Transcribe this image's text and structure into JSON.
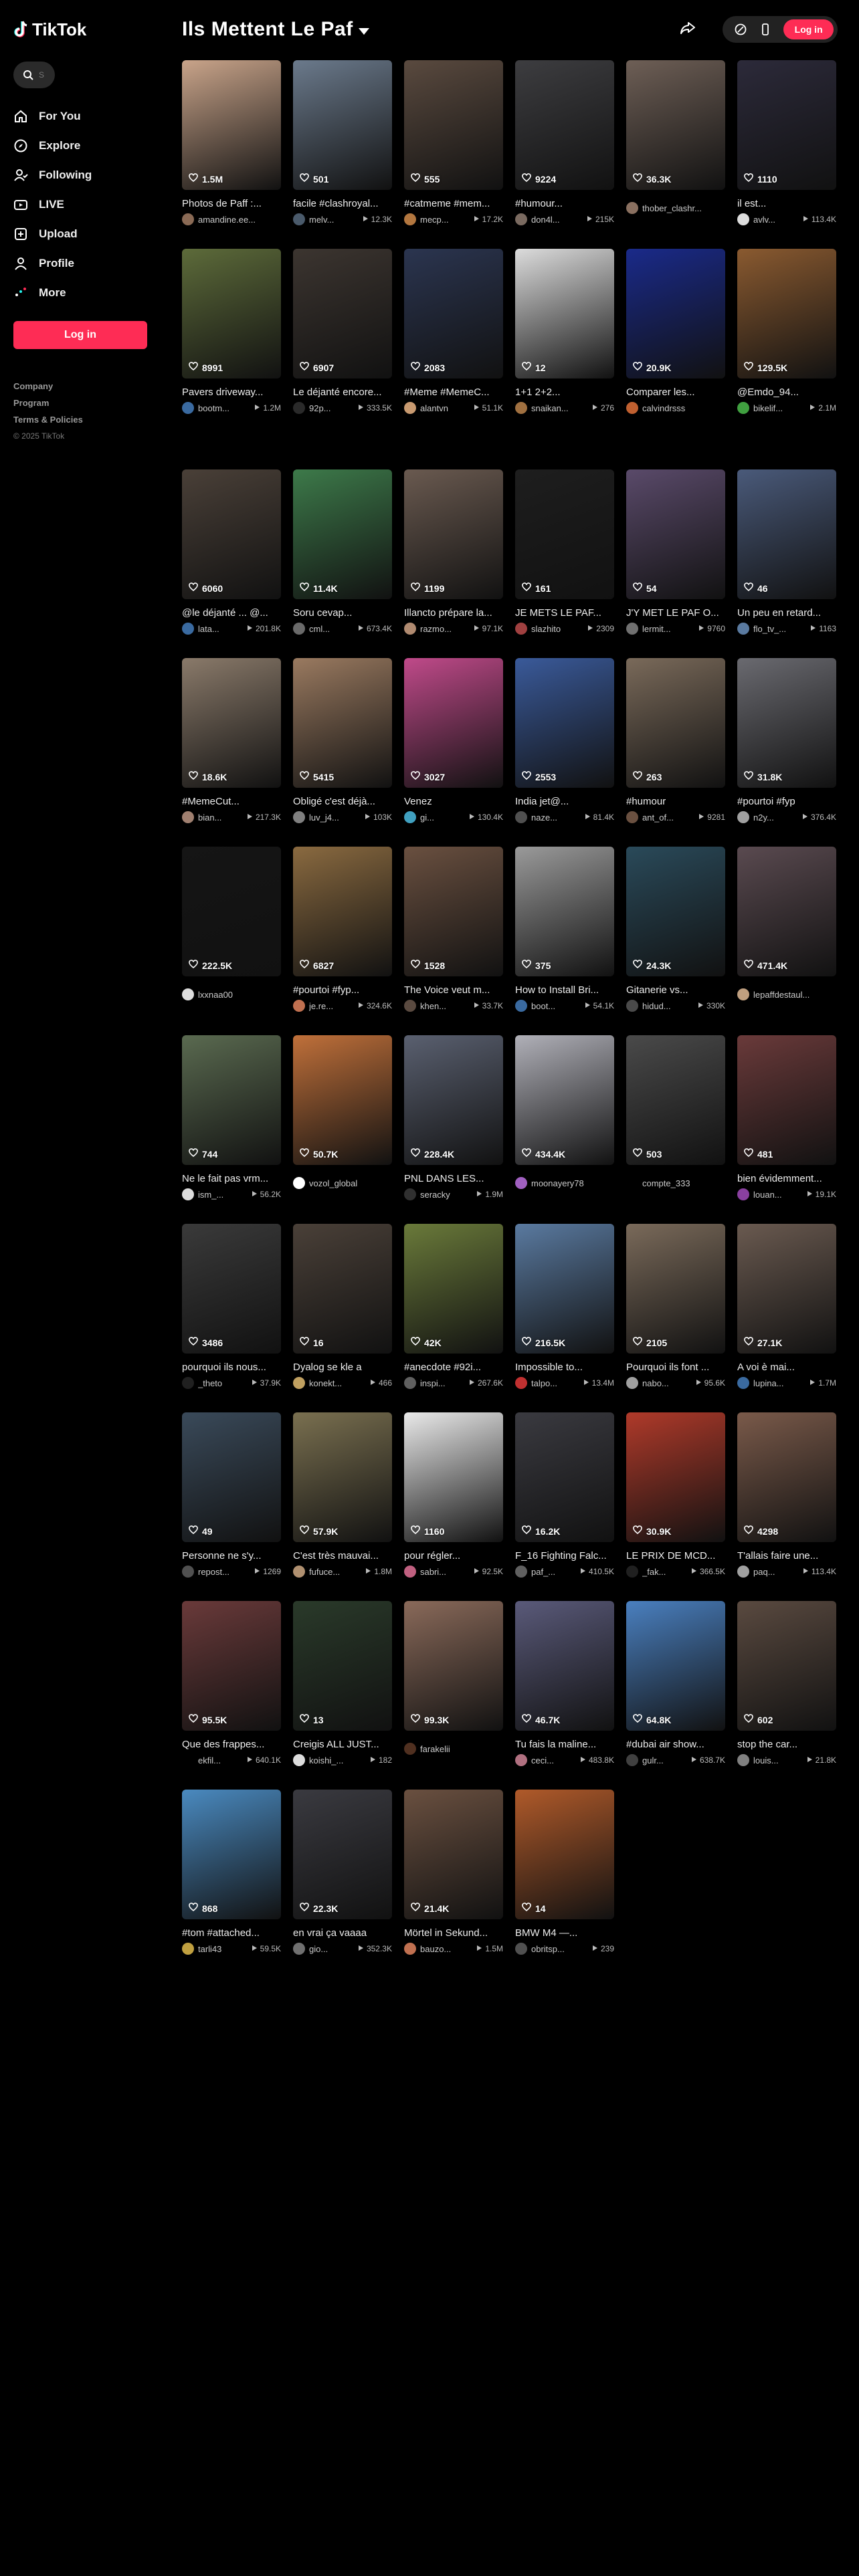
{
  "app": {
    "name": "TikTok"
  },
  "search": {
    "placeholder": "S"
  },
  "nav": [
    {
      "label": "For You",
      "icon": "home-icon"
    },
    {
      "label": "Explore",
      "icon": "compass-icon"
    },
    {
      "label": "Following",
      "icon": "following-icon"
    },
    {
      "label": "LIVE",
      "icon": "live-icon"
    },
    {
      "label": "Upload",
      "icon": "upload-icon"
    },
    {
      "label": "Profile",
      "icon": "profile-icon"
    },
    {
      "label": "More",
      "icon": "more-icon"
    }
  ],
  "sidebar": {
    "login_label": "Log in"
  },
  "footer": {
    "company": "Company",
    "program": "Program",
    "terms": "Terms & Policies",
    "copyright": "© 2025 TikTok"
  },
  "header": {
    "title": "Ils Mettent Le Paf",
    "login_label": "Log in"
  },
  "colors": {
    "accent": "#fe2c55",
    "background": "#000000"
  },
  "videos_top": [
    {
      "views": "1.5M",
      "caption": "Photos de Paff :...",
      "author": "amandine.ee...",
      "plays": "",
      "thumb": "#c9a48a",
      "avatar": "#8a6a55"
    },
    {
      "views": "501",
      "caption": "facile #clashroyal...",
      "author": "melv...",
      "plays": "12.3K",
      "thumb": "#6b7a8c",
      "avatar": "#4a5a6b"
    },
    {
      "views": "555",
      "caption": "#catmeme #mem...",
      "author": "mecp...",
      "plays": "17.2K",
      "thumb": "#5a4a3f",
      "avatar": "#b3773f"
    },
    {
      "views": "9224",
      "caption": "#humour...",
      "author": "don4l...",
      "plays": "215K",
      "thumb": "#3d3d40",
      "avatar": "#7a6a60"
    },
    {
      "views": "36.3K",
      "caption": "",
      "author": "thober_clashr...",
      "plays": "",
      "thumb": "#6e5f56",
      "avatar": "#8a7060"
    },
    {
      "views": "1110",
      "caption": "il est...",
      "author": "avlv...",
      "plays": "113.4K",
      "thumb": "#2c2a3a",
      "avatar": "#dddddd"
    },
    {
      "views": "8991",
      "caption": "Pavers driveway...",
      "author": "bootm...",
      "plays": "1.2M",
      "thumb": "#5d6b3a",
      "avatar": "#3a6aa0"
    },
    {
      "views": "6907",
      "caption": "Le déjanté encore...",
      "author": "92p...",
      "plays": "333.5K",
      "thumb": "#3c3530",
      "avatar": "#2a2a2a"
    },
    {
      "views": "2083",
      "caption": "#Meme #MemeC...",
      "author": "alantvn",
      "plays": "51.1K",
      "thumb": "#2b3550",
      "avatar": "#c89a70"
    },
    {
      "views": "12",
      "caption": "1+1 2+2...",
      "author": "snaikan...",
      "plays": "276",
      "thumb": "#dcdcdc",
      "avatar": "#a07040"
    },
    {
      "views": "20.9K",
      "caption": "Comparer les...",
      "author": "calvindrsss",
      "plays": "",
      "thumb": "#1a2a8a",
      "avatar": "#c06030"
    },
    {
      "views": "129.5K",
      "caption": "@Emdo_94...",
      "author": "bikelif...",
      "plays": "2.1M",
      "thumb": "#8a5a30",
      "avatar": "#40a040"
    }
  ],
  "videos_main": [
    {
      "views": "6060",
      "caption": "@le déjanté ... @...",
      "author": "lata...",
      "plays": "201.8K",
      "thumb": "#4a4038",
      "avatar": "#3a6aa0"
    },
    {
      "views": "11.4K",
      "caption": "Soru cevap...",
      "author": "cml...",
      "plays": "673.4K",
      "thumb": "#3d7a4a",
      "avatar": "#6a6a6a"
    },
    {
      "views": "1199",
      "caption": "Illancto prépare la...",
      "author": "razmo...",
      "plays": "97.1K",
      "thumb": "#6a5a50",
      "avatar": "#b08a70"
    },
    {
      "views": "161",
      "caption": "JE METS LE PAF...",
      "author": "slazhito",
      "plays": "2309",
      "thumb": "#1e1e1e",
      "avatar": "#a04040"
    },
    {
      "views": "54",
      "caption": "J'Y MET LE PAF O...",
      "author": "lermit...",
      "plays": "9760",
      "thumb": "#5a4a6a",
      "avatar": "#707070"
    },
    {
      "views": "46",
      "caption": "Un peu en retard...",
      "author": "flo_tv_...",
      "plays": "1163",
      "thumb": "#4a5a7a",
      "avatar": "#5a7aa0"
    },
    {
      "views": "18.6K",
      "caption": "#MemeCut...",
      "author": "bian...",
      "plays": "217.3K",
      "thumb": "#8a7a6a",
      "avatar": "#a08070"
    },
    {
      "views": "5415",
      "caption": "Obligé c'est déjà...",
      "author": "luv_j4...",
      "plays": "103K",
      "thumb": "#9a7a60",
      "avatar": "#808080"
    },
    {
      "views": "3027",
      "caption": "Venez",
      "author": "gi...",
      "plays": "130.4K",
      "thumb": "#c04a8a",
      "avatar": "#40a0c0"
    },
    {
      "views": "2553",
      "caption": "India jet@...",
      "author": "naze...",
      "plays": "81.4K",
      "thumb": "#3a5a9a",
      "avatar": "#505050"
    },
    {
      "views": "263",
      "caption": "#humour",
      "author": "ant_of...",
      "plays": "9281",
      "thumb": "#7a6a5a",
      "avatar": "#6a5040"
    },
    {
      "views": "31.8K",
      "caption": "#pourtoi #fyp",
      "author": "n2y...",
      "plays": "376.4K",
      "thumb": "#6a6a70",
      "avatar": "#a0a0a0"
    },
    {
      "views": "222.5K",
      "caption": "",
      "author": "lxxnaa00",
      "plays": "",
      "thumb": "#151515",
      "avatar": "#dddddd"
    },
    {
      "views": "6827",
      "caption": "#pourtoi #fyp...",
      "author": "je.re...",
      "plays": "324.6K",
      "thumb": "#8a6a40",
      "avatar": "#c07050"
    },
    {
      "views": "1528",
      "caption": "The Voice veut m...",
      "author": "khen...",
      "plays": "33.7K",
      "thumb": "#6a5040",
      "avatar": "#5a4a40"
    },
    {
      "views": "375",
      "caption": "How to Install Bri...",
      "author": "boot...",
      "plays": "54.1K",
      "thumb": "#9a9a9a",
      "avatar": "#3a6aa0"
    },
    {
      "views": "24.3K",
      "caption": "Gitanerie vs...",
      "author": "hidud...",
      "plays": "330K",
      "thumb": "#2a4a5a",
      "avatar": "#4a4a4a"
    },
    {
      "views": "471.4K",
      "caption": "",
      "author": "lepaffdestaul...",
      "plays": "",
      "thumb": "#5a4a50",
      "avatar": "#c0a080"
    },
    {
      "views": "744",
      "caption": "Ne le fait pas vrm...",
      "author": "ism_...",
      "plays": "56.2K",
      "thumb": "#5a6a50",
      "avatar": "#dddddd"
    },
    {
      "views": "50.7K",
      "caption": "",
      "author": "vozol_global",
      "plays": "",
      "thumb": "#c0703a",
      "avatar": "#ffffff"
    },
    {
      "views": "228.4K",
      "caption": "PNL DANS LES...",
      "author": "seracky",
      "plays": "1.9M",
      "thumb": "#5a6070",
      "avatar": "#303030"
    },
    {
      "views": "434.4K",
      "caption": "",
      "author": "moonayery78",
      "plays": "",
      "thumb": "#b0b0b8",
      "avatar": "#a060c0"
    },
    {
      "views": "503",
      "caption": "",
      "author": "compte_333",
      "plays": "",
      "thumb": "#4a4a4a",
      "avatar": "#000000"
    },
    {
      "views": "481",
      "caption": "bien évidemment...",
      "author": "louan...",
      "plays": "19.1K",
      "thumb": "#6a3a3a",
      "avatar": "#8a40a0"
    },
    {
      "views": "3486",
      "caption": "pourquoi ils nous...",
      "author": "_theto",
      "plays": "37.9K",
      "thumb": "#3a3a3a",
      "avatar": "#202020"
    },
    {
      "views": "16",
      "caption": "Dyalog se kle a",
      "author": "konekt...",
      "plays": "466",
      "thumb": "#4a4038",
      "avatar": "#c0a060"
    },
    {
      "views": "42K",
      "caption": "#anecdote #92i...",
      "author": "inspi...",
      "plays": "267.6K",
      "thumb": "#6a7a3a",
      "avatar": "#606060"
    },
    {
      "views": "216.5K",
      "caption": "Impossible to...",
      "author": "talpo...",
      "plays": "13.4M",
      "thumb": "#5a7aa0",
      "avatar": "#c03030"
    },
    {
      "views": "2105",
      "caption": "Pourquoi ils font ...",
      "author": "nabo...",
      "plays": "95.6K",
      "thumb": "#7a6a5a",
      "avatar": "#a0a0a0"
    },
    {
      "views": "27.1K",
      "caption": "A voi è mai...",
      "author": "lupina...",
      "plays": "1.7M",
      "thumb": "#6a5a50",
      "avatar": "#3a6aa0"
    },
    {
      "views": "49",
      "caption": "Personne ne s'y...",
      "author": "repost...",
      "plays": "1269",
      "thumb": "#3a4a5a",
      "avatar": "#505050"
    },
    {
      "views": "57.9K",
      "caption": "C'est très mauvai...",
      "author": "fufuce...",
      "plays": "1.8M",
      "thumb": "#7a7050",
      "avatar": "#b09070"
    },
    {
      "views": "1160",
      "caption": "pour régler...",
      "author": "sabri...",
      "plays": "92.5K",
      "thumb": "#eaeaea",
      "avatar": "#c06080"
    },
    {
      "views": "16.2K",
      "caption": "F_16 Fighting Falc...",
      "author": "paf_...",
      "plays": "410.5K",
      "thumb": "#3a3a40",
      "avatar": "#606060"
    },
    {
      "views": "30.9K",
      "caption": "LE PRIX DE MCD...",
      "author": "_fak...",
      "plays": "366.5K",
      "thumb": "#b03a2a",
      "avatar": "#202020"
    },
    {
      "views": "4298",
      "caption": "T'allais faire une...",
      "author": "paq...",
      "plays": "113.4K",
      "thumb": "#7a5a4a",
      "avatar": "#a0a0a0"
    },
    {
      "views": "95.5K",
      "caption": "Que des frappes...",
      "author": "ekfil...",
      "plays": "640.1K",
      "thumb": "#6a3a3a",
      "avatar": "#000000"
    },
    {
      "views": "13",
      "caption": "Creigis ALL JUST...",
      "author": "koishi_...",
      "plays": "182",
      "thumb": "#2a3a2a",
      "avatar": "#dddddd"
    },
    {
      "views": "99.3K",
      "caption": "",
      "author": "farakelii",
      "plays": "",
      "thumb": "#8a6a5a",
      "avatar": "#503020"
    },
    {
      "views": "46.7K",
      "caption": "Tu fais la maline...",
      "author": "ceci...",
      "plays": "483.8K",
      "thumb": "#5a5a7a",
      "avatar": "#b07080"
    },
    {
      "views": "64.8K",
      "caption": "#dubai air show...",
      "author": "gulr...",
      "plays": "638.7K",
      "thumb": "#4a80c0",
      "avatar": "#404040"
    },
    {
      "views": "602",
      "caption": "stop the car...",
      "author": "louis...",
      "plays": "21.8K",
      "thumb": "#5a4a40",
      "avatar": "#808080"
    },
    {
      "views": "868",
      "caption": "#tom #attached...",
      "author": "tarli43",
      "plays": "59.5K",
      "thumb": "#4a8ac0",
      "avatar": "#c0a040"
    },
    {
      "views": "22.3K",
      "caption": "en vrai ça vaaaa",
      "author": "gio...",
      "plays": "352.3K",
      "thumb": "#3a3a40",
      "avatar": "#707070"
    },
    {
      "views": "21.4K",
      "caption": "Mörtel in Sekund...",
      "author": "bauzo...",
      "plays": "1.5M",
      "thumb": "#6a5040",
      "avatar": "#c07050"
    },
    {
      "views": "14",
      "caption": "BMW M4 —...",
      "author": "obritsp...",
      "plays": "239",
      "thumb": "#b05a2a",
      "avatar": "#505050"
    }
  ]
}
